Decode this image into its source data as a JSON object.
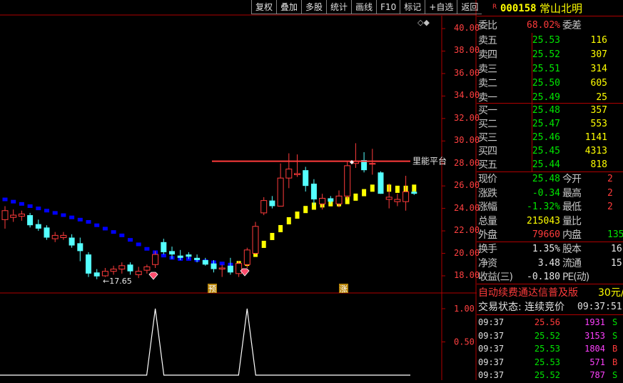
{
  "toolbar": [
    "复权",
    "叠加",
    "多股",
    "统计",
    "画线",
    "F10",
    "标记",
    "+自选",
    "返回"
  ],
  "diamond_icons": "◇◆",
  "chart_data": {
    "type": "candlestick",
    "y_ticks": [
      "40.00",
      "38.00",
      "36.00",
      "34.00",
      "32.00",
      "30.00",
      "28.00",
      "26.00",
      "24.00",
      "22.00",
      "20.00",
      "18.00"
    ],
    "ylim": [
      17.0,
      41.0
    ],
    "candles": [
      {
        "o": 23.0,
        "h": 24.2,
        "l": 22.2,
        "c": 23.8,
        "up": true
      },
      {
        "o": 23.2,
        "h": 23.9,
        "l": 22.8,
        "c": 23.4,
        "up": true
      },
      {
        "o": 23.3,
        "h": 23.8,
        "l": 22.9,
        "c": 23.5,
        "up": true
      },
      {
        "o": 23.4,
        "h": 23.6,
        "l": 22.3,
        "c": 22.5,
        "up": false
      },
      {
        "o": 22.6,
        "h": 23.0,
        "l": 22.0,
        "c": 22.2,
        "up": false
      },
      {
        "o": 22.3,
        "h": 22.5,
        "l": 21.2,
        "c": 21.4,
        "up": false
      },
      {
        "o": 21.3,
        "h": 21.9,
        "l": 21.0,
        "c": 21.6,
        "up": true
      },
      {
        "o": 21.6,
        "h": 21.9,
        "l": 21.2,
        "c": 21.4,
        "up": true
      },
      {
        "o": 21.4,
        "h": 21.7,
        "l": 20.5,
        "c": 20.7,
        "up": false
      },
      {
        "o": 20.9,
        "h": 21.4,
        "l": 19.3,
        "c": 20.2,
        "up": false
      },
      {
        "o": 19.9,
        "h": 20.1,
        "l": 17.9,
        "c": 18.2,
        "up": false
      },
      {
        "o": 18.3,
        "h": 18.6,
        "l": 17.7,
        "c": 17.95,
        "up": false
      },
      {
        "o": 18.0,
        "h": 18.7,
        "l": 17.9,
        "c": 18.4,
        "up": true
      },
      {
        "o": 18.4,
        "h": 18.9,
        "l": 18.1,
        "c": 18.6,
        "up": true
      },
      {
        "o": 18.6,
        "h": 19.2,
        "l": 18.2,
        "c": 18.9,
        "up": true
      },
      {
        "o": 19.0,
        "h": 19.2,
        "l": 18.1,
        "c": 18.4,
        "up": false
      },
      {
        "o": 18.1,
        "h": 18.8,
        "l": 17.8,
        "c": 18.4,
        "up": true
      },
      {
        "o": 18.5,
        "h": 19.0,
        "l": 18.2,
        "c": 18.8,
        "up": true
      },
      {
        "o": 19.0,
        "h": 20.2,
        "l": 18.7,
        "c": 19.9,
        "up": true
      },
      {
        "o": 21.0,
        "h": 21.3,
        "l": 19.9,
        "c": 20.1,
        "up": false
      },
      {
        "o": 20.2,
        "h": 20.6,
        "l": 19.5,
        "c": 19.9,
        "up": false
      },
      {
        "o": 19.8,
        "h": 20.3,
        "l": 19.4,
        "c": 19.6,
        "up": false
      },
      {
        "o": 19.9,
        "h": 20.1,
        "l": 19.5,
        "c": 19.7,
        "up": false
      },
      {
        "o": 19.6,
        "h": 19.9,
        "l": 19.2,
        "c": 19.4,
        "up": false
      },
      {
        "o": 19.4,
        "h": 19.6,
        "l": 18.9,
        "c": 19.0,
        "up": false
      },
      {
        "o": 19.1,
        "h": 19.4,
        "l": 18.3,
        "c": 18.6,
        "up": false
      },
      {
        "o": 18.6,
        "h": 19.0,
        "l": 17.9,
        "c": 18.7,
        "up": true
      },
      {
        "o": 18.9,
        "h": 19.6,
        "l": 18.1,
        "c": 18.3,
        "up": false
      },
      {
        "o": 18.2,
        "h": 19.3,
        "l": 17.9,
        "c": 19.1,
        "up": true
      },
      {
        "o": 19.0,
        "h": 20.5,
        "l": 18.7,
        "c": 20.3,
        "up": true
      },
      {
        "o": 20.0,
        "h": 22.8,
        "l": 19.9,
        "c": 22.4,
        "up": true
      },
      {
        "o": 23.6,
        "h": 25.0,
        "l": 23.4,
        "c": 24.7,
        "up": true
      },
      {
        "o": 24.7,
        "h": 25.1,
        "l": 24.0,
        "c": 24.2,
        "up": false
      },
      {
        "o": 24.2,
        "h": 28.0,
        "l": 24.2,
        "c": 26.7,
        "up": true
      },
      {
        "o": 26.7,
        "h": 28.9,
        "l": 25.8,
        "c": 27.5,
        "up": true
      },
      {
        "o": 27.0,
        "h": 28.8,
        "l": 26.8,
        "c": 27.1,
        "up": true
      },
      {
        "o": 27.4,
        "h": 27.7,
        "l": 25.5,
        "c": 26.0,
        "up": false
      },
      {
        "o": 26.2,
        "h": 26.6,
        "l": 24.3,
        "c": 24.8,
        "up": false
      },
      {
        "o": 24.4,
        "h": 25.3,
        "l": 23.9,
        "c": 24.9,
        "up": true
      },
      {
        "o": 24.9,
        "h": 25.1,
        "l": 24.4,
        "c": 24.6,
        "up": false
      },
      {
        "o": 24.4,
        "h": 25.6,
        "l": 24.1,
        "c": 25.1,
        "up": true
      },
      {
        "o": 25.1,
        "h": 28.2,
        "l": 24.8,
        "c": 27.8,
        "up": true
      },
      {
        "o": 28.0,
        "h": 29.8,
        "l": 27.6,
        "c": 28.2,
        "up": true
      },
      {
        "o": 28.3,
        "h": 29.0,
        "l": 27.2,
        "c": 27.4,
        "up": false
      },
      {
        "o": 28.0,
        "h": 29.3,
        "l": 27.0,
        "c": 28.0,
        "up": true
      },
      {
        "o": 27.2,
        "h": 27.3,
        "l": 25.3,
        "c": 25.3,
        "up": false
      },
      {
        "o": 25.0,
        "h": 26.2,
        "l": 24.0,
        "c": 24.8,
        "up": true
      },
      {
        "o": 24.8,
        "h": 25.3,
        "l": 24.2,
        "c": 24.6,
        "up": true
      },
      {
        "o": 24.6,
        "h": 26.9,
        "l": 23.8,
        "c": 25.48,
        "up": true
      },
      {
        "o": 25.3,
        "h": 25.6,
        "l": 25.2,
        "c": 25.48,
        "up": false
      }
    ],
    "ma": [
      24.8,
      24.6,
      24.4,
      24.2,
      24.0,
      23.8,
      23.6,
      23.4,
      23.2,
      23.0,
      22.8,
      22.5,
      22.2,
      21.9,
      21.6,
      21.2,
      20.8,
      20.4,
      20.1,
      19.8,
      19.6,
      19.5,
      19.5,
      19.4,
      19.3,
      19.2,
      19.1,
      19.0,
      19.0,
      19.2,
      20.0,
      20.8,
      21.5,
      22.2,
      22.9,
      23.4,
      23.9,
      24.2,
      24.4,
      24.5,
      24.5,
      24.7,
      25.0,
      25.4,
      25.8,
      25.9,
      25.8,
      25.7,
      25.7,
      25.8
    ],
    "resistance_label": "里能平台",
    "resistance_level": 28.2,
    "low_label": "←17.65",
    "marker_yu": "预",
    "marker_zhang": "涨",
    "sub_y_ticks": [
      "1.00",
      "0.50"
    ],
    "sub_spikes": [
      18,
      29
    ]
  },
  "stock": {
    "flag": "R",
    "code": "000158",
    "name": "常山北明"
  },
  "quote": {
    "weibi_label": "委比",
    "weibi": "68.02%",
    "weicha_label": "委差",
    "sell": [
      {
        "label": "卖五",
        "price": "25.53",
        "vol": "116"
      },
      {
        "label": "卖四",
        "price": "25.52",
        "vol": "307"
      },
      {
        "label": "卖三",
        "price": "25.51",
        "vol": "314"
      },
      {
        "label": "卖二",
        "price": "25.50",
        "vol": "605"
      },
      {
        "label": "卖一",
        "price": "25.49",
        "vol": "25"
      }
    ],
    "buy": [
      {
        "label": "买一",
        "price": "25.48",
        "vol": "357"
      },
      {
        "label": "买二",
        "price": "25.47",
        "vol": "553"
      },
      {
        "label": "买三",
        "price": "25.46",
        "vol": "1141"
      },
      {
        "label": "买四",
        "price": "25.45",
        "vol": "4313"
      },
      {
        "label": "买五",
        "price": "25.44",
        "vol": "818"
      }
    ],
    "stats": [
      {
        "l1": "现价",
        "v1": "25.48",
        "c1": "green",
        "l2": "今开",
        "v2": "2",
        "c2": "red"
      },
      {
        "l1": "涨跌",
        "v1": "-0.34",
        "c1": "green",
        "l2": "最高",
        "v2": "2",
        "c2": "red"
      },
      {
        "l1": "涨幅",
        "v1": "-1.32%",
        "c1": "green",
        "l2": "最低",
        "v2": "2",
        "c2": "red"
      },
      {
        "l1": "总量",
        "v1": "215043",
        "c1": "yellow",
        "l2": "量比",
        "v2": "",
        "c2": "white"
      },
      {
        "l1": "外盘",
        "v1": "79660",
        "c1": "red",
        "l2": "内盘",
        "v2": "135",
        "c2": "green"
      }
    ],
    "stats2": [
      {
        "l1": "换手",
        "v1": "1.35%",
        "l2": "股本",
        "v2": "16"
      },
      {
        "l1": "净资",
        "v1": "3.48",
        "l2": "流通",
        "v2": "15"
      },
      {
        "l1": "收益(三)",
        "v1": "-0.180",
        "l2": "PE(动)",
        "v2": ""
      }
    ],
    "promo": "自动续费通达信普及版",
    "promo_price": "30元/",
    "trade_status_label": "交易状态: 连续竞价",
    "trade_time": "09:37:51",
    "ticks": [
      {
        "t": "09:37",
        "p": "25.56",
        "v": "1931",
        "s": "S",
        "pc": "red",
        "vc": "magenta",
        "sc": "green"
      },
      {
        "t": "09:37",
        "p": "25.52",
        "v": "3153",
        "s": "S",
        "pc": "green",
        "vc": "magenta",
        "sc": "green"
      },
      {
        "t": "09:37",
        "p": "25.53",
        "v": "1804",
        "s": "B",
        "pc": "green",
        "vc": "magenta",
        "sc": "red"
      },
      {
        "t": "09:37",
        "p": "25.53",
        "v": "571",
        "s": "B",
        "pc": "green",
        "vc": "magenta",
        "sc": "red"
      },
      {
        "t": "09:37",
        "p": "25.52",
        "v": "787",
        "s": "S",
        "pc": "green",
        "vc": "magenta",
        "sc": "green"
      }
    ]
  },
  "colors": {
    "up": "#ff3b3b",
    "down": "#54ffff",
    "ma_bear": "#0000ff",
    "ma_bull": "#ffff00",
    "grid": "#b00000"
  }
}
